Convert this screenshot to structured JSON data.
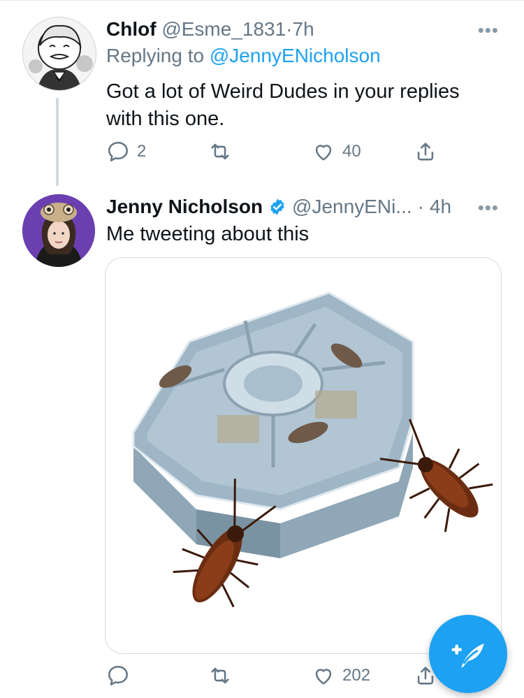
{
  "tweets": [
    {
      "display_name": "Chlof",
      "handle": "@Esme_1831",
      "time": "7h",
      "replying_prefix": "Replying to",
      "replying_to": "@JennyENicholson",
      "text": "Got a lot of Weird Dudes in your replies with this one.",
      "replies": "2",
      "retweets": "",
      "likes": "40"
    },
    {
      "display_name": "Jenny Nicholson",
      "handle": "@JennyENi...",
      "time": "4h",
      "verified": true,
      "text": "Me tweeting about this",
      "replies": "",
      "retweets": "",
      "likes": "202"
    }
  ],
  "ui": {
    "separator": "·",
    "more": "•••",
    "accent": "#1da1f2",
    "muted": "#657786"
  }
}
